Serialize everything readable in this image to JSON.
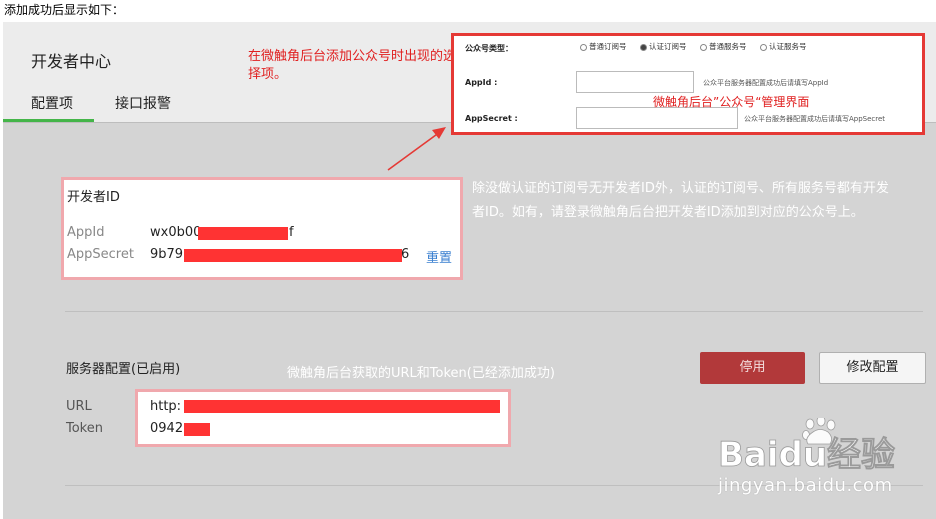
{
  "caption": "添加成功后显示如下：",
  "header": {
    "title": "开发者中心",
    "tabs": [
      "配置项",
      "接口报警"
    ]
  },
  "annotation_left": "在微触角后台添加公众号时出现的选择项。",
  "mp_panel": {
    "type_label": "公众号类型：",
    "options": [
      "普通订阅号",
      "认证订阅号",
      "普通服务号",
      "认证服务号"
    ],
    "selected_index": 1,
    "appid_label": "AppId :",
    "appid_hint": "公众平台服务器配置成功后请填写AppId",
    "secret_label": "AppSecret :",
    "secret_hint": "公众平台服务器配置成功后请填写AppSecret",
    "overlay_label": "微触角后台”公众号“管理界面"
  },
  "developer_id": {
    "title": "开发者ID",
    "appid_label": "AppId",
    "appid_prefix": "wx0b00",
    "appid_suffix": "f",
    "secret_label": "AppSecret",
    "secret_prefix": "9b79",
    "secret_suffix": "6",
    "reset": "重置"
  },
  "description": "除没做认证的订阅号无开发者ID外，认证的订阅号、所有服务号都有开发者ID。如有，请登录微触角后台把开发者ID添加到对应的公众号上。",
  "server": {
    "title": "服务器配置(已启用)",
    "note": "微触角后台获取的URL和Token(已经添加成功)",
    "stop_button": "停用",
    "edit_button": "修改配置",
    "url_label": "URL",
    "token_label": "Token",
    "url_prefix": "http:",
    "token_prefix": "0942"
  },
  "watermark": {
    "brand": "Baidu经验",
    "url": "jingyan.baidu.com"
  },
  "colors": {
    "accent_green": "#44b549",
    "stop_red": "#b2393a",
    "highlight_red": "#e53935",
    "link_blue": "#3a7fd0"
  }
}
